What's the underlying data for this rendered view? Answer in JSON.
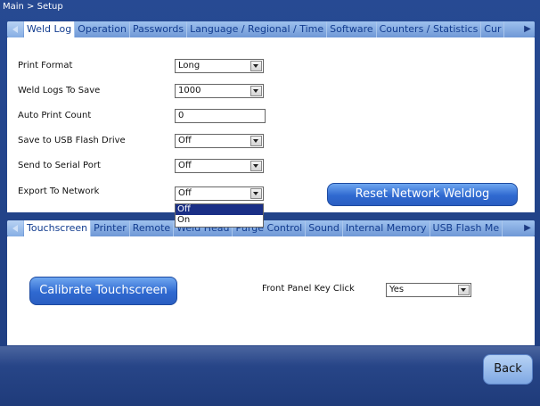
{
  "breadcrumb": "Main > Setup",
  "top_tabs": [
    "Weld Log",
    "Operation",
    "Passwords",
    "Language / Regional / Time",
    "Software",
    "Counters / Statistics",
    "Cur"
  ],
  "top_active_tab": "Weld Log",
  "weld_log": {
    "print_format": {
      "label": "Print Format",
      "value": "Long"
    },
    "weld_logs_to_save": {
      "label": "Weld Logs To Save",
      "value": "1000"
    },
    "auto_print_count": {
      "label": "Auto Print Count",
      "value": "0"
    },
    "save_to_usb": {
      "label": "Save to USB Flash Drive",
      "value": "Off"
    },
    "send_to_serial": {
      "label": "Send to Serial Port",
      "value": "Off"
    },
    "export_to_network": {
      "label": "Export To Network",
      "value": "Off",
      "options": [
        "Off",
        "On"
      ],
      "dropdown_open": true
    },
    "reset_button": "Reset Network Weldlog"
  },
  "bottom_tabs": [
    "Touchscreen",
    "Printer",
    "Remote",
    "Weld Head",
    "Purge Control",
    "Sound",
    "Internal Memory",
    "USB Flash Me"
  ],
  "bottom_active_tab": "Touchscreen",
  "touchscreen": {
    "calibrate_button": "Calibrate Touchscreen",
    "front_panel_label": "Front Panel Key Click",
    "front_panel_value": "Yes"
  },
  "footer": {
    "back_button": "Back"
  },
  "colors": {
    "background": "#274a93",
    "tab_bar": "#9ec1ee",
    "button_blue": "#2f69d0",
    "selection": "#1a2f86"
  },
  "icons": [
    "scroll-left-icon",
    "scroll-right-icon",
    "dropdown-arrow-icon"
  ]
}
